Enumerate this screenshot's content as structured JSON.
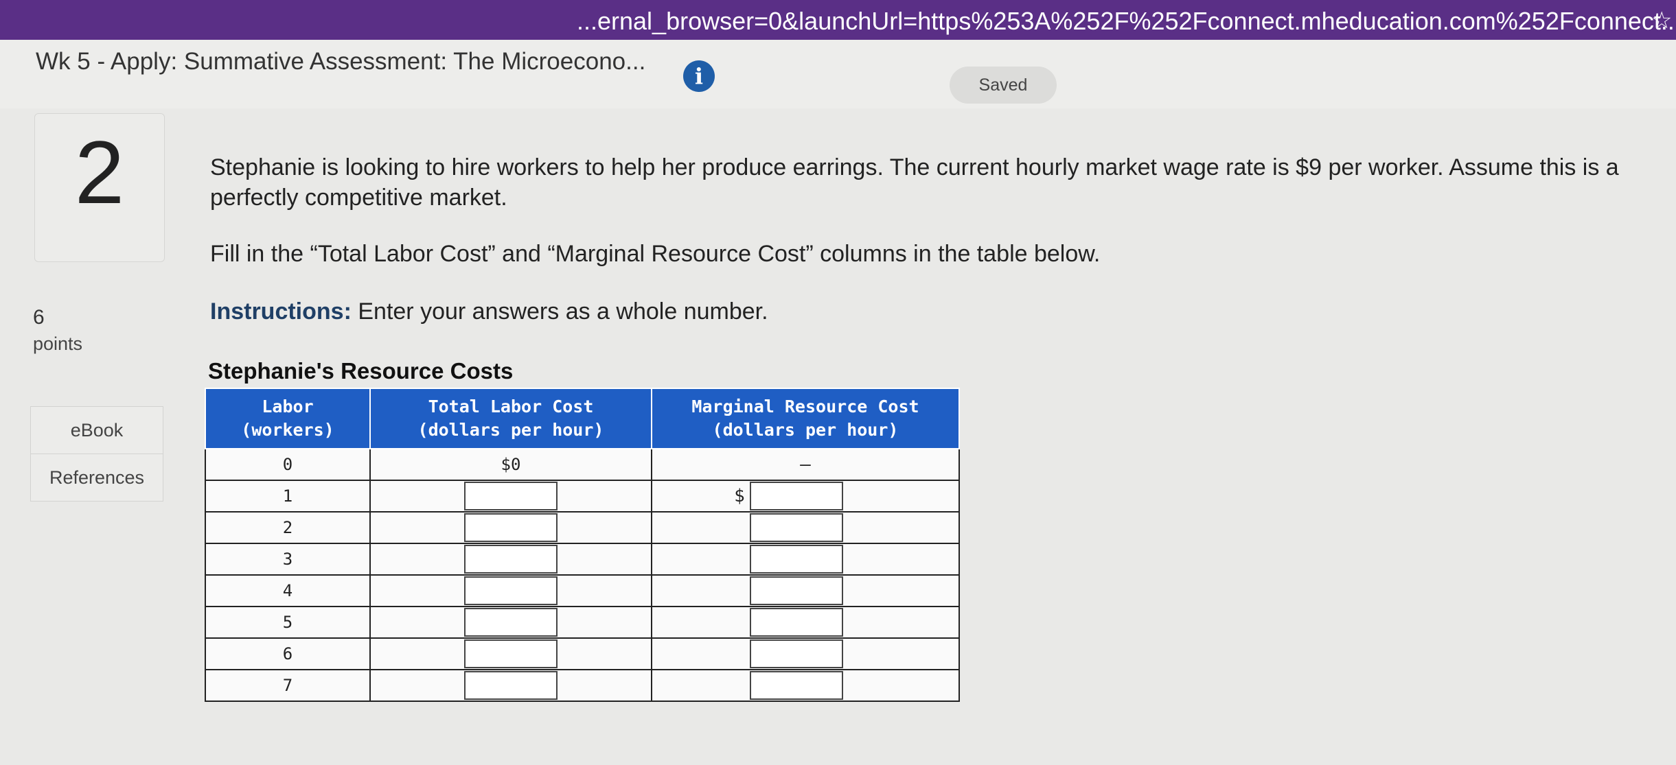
{
  "browser": {
    "url": "...ernal_browser=0&launchUrl=https%253A%252F%252Fconnect.mheducation.com%252Fconnect...",
    "bookmark_icon": "star-icon"
  },
  "header": {
    "title": "Wk 5 - Apply: Summative Assessment: The Microecono...",
    "info_icon_glyph": "i",
    "saved_label": "Saved"
  },
  "question": {
    "number": "2",
    "points_value": "6",
    "points_label": "points",
    "prompt": "Stephanie is looking to hire workers to help her produce earrings. The current hourly market wage rate is $9 per worker. Assume this is a perfectly competitive market.",
    "fill_in": "Fill in the “Total Labor Cost” and “Marginal Resource Cost” columns in the table below.",
    "instructions_label": "Instructions:",
    "instructions_text": " Enter your answers as a whole number."
  },
  "sidebar": {
    "ebook_label": "eBook",
    "references_label": "References"
  },
  "table": {
    "title": "Stephanie's Resource Costs",
    "headers": [
      "Labor\n(workers)",
      "Total Labor Cost\n(dollars per hour)",
      "Marginal Resource Cost\n(dollars per hour)"
    ],
    "first_row": {
      "labor": "0",
      "tlc": "$0",
      "mrc": "–"
    },
    "dollar_sign": "$",
    "labor_values": [
      "1",
      "2",
      "3",
      "4",
      "5",
      "6",
      "7"
    ]
  },
  "colors": {
    "url_bar": "#5a2f86",
    "table_header": "#1f5ec4",
    "info_icon": "#1f5ea8"
  }
}
